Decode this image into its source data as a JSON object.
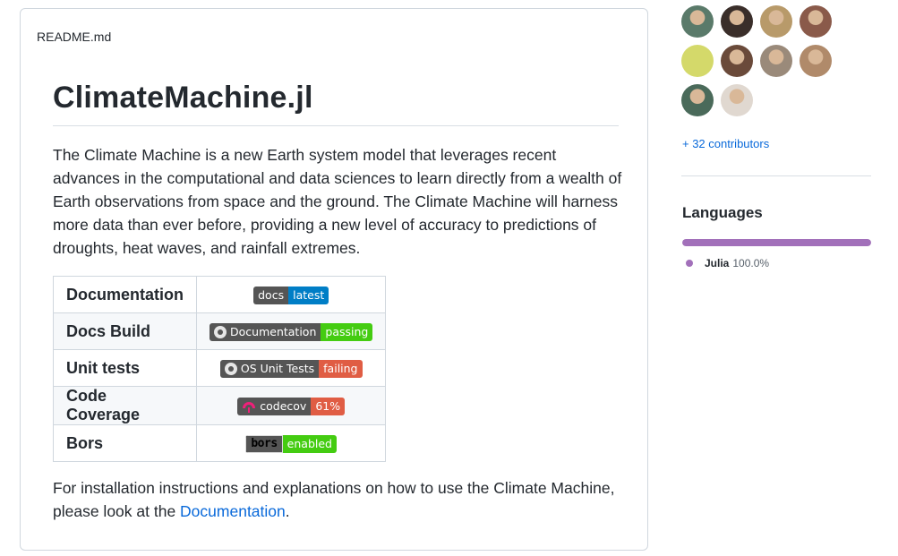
{
  "readme": {
    "filename": "README.md",
    "title": "ClimateMachine.jl",
    "intro": "The Climate Machine is a new Earth system model that leverages recent advances in the computational and data sciences to learn directly from a wealth of Earth observations from space and the ground. The Climate Machine will harness more data than ever before, providing a new level of accuracy to predictions of droughts, heat waves, and rainfall extremes.",
    "status_table": [
      {
        "label": "Documentation",
        "badge_left": "docs",
        "badge_right": "latest",
        "badge_color": "#007ec6",
        "logo": "none"
      },
      {
        "label": "Docs Build",
        "badge_left": "Documentation",
        "badge_right": "passing",
        "badge_color": "#4c1",
        "logo": "github-icon"
      },
      {
        "label": "Unit tests",
        "badge_left": "OS Unit Tests",
        "badge_right": "failing",
        "badge_color": "#e05d44",
        "logo": "github-icon"
      },
      {
        "label": "Code Coverage",
        "badge_left": "codecov",
        "badge_right": "61%",
        "badge_color": "#e05d44",
        "logo": "codecov-icon"
      },
      {
        "label": "Bors",
        "badge_left": "bors",
        "badge_right": "enabled",
        "badge_color": "#4c1",
        "logo": "bors-icon"
      }
    ],
    "outro_before_link": "For installation instructions and explanations on how to use the Climate Machine, please look at the ",
    "outro_link": "Documentation",
    "outro_after_link": "."
  },
  "sidebar": {
    "contributors_link": "+ 32 contributors",
    "languages_heading": "Languages",
    "languages": [
      {
        "name": "Julia",
        "percent": "100.0%",
        "share": 1.0,
        "color": "#a270ba"
      }
    ],
    "avatar_count": 10
  },
  "colors": {
    "link": "#0969da",
    "border": "#d0d7de"
  }
}
